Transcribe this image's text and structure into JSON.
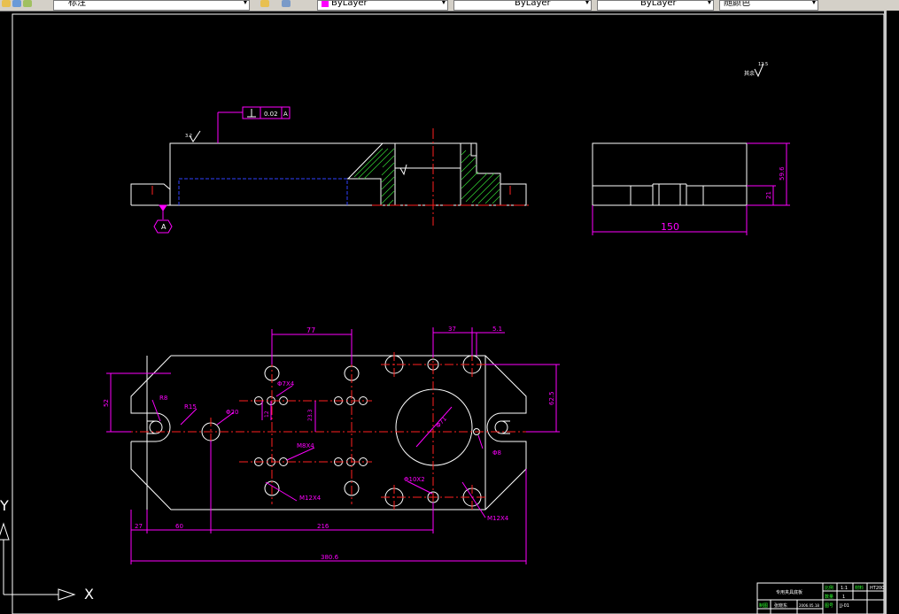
{
  "toolbar": {
    "text_style": "标注",
    "layer": "ByLayer",
    "linetype": "ByLayer",
    "lineweight": "ByLayer",
    "plot_style": "随颜色"
  },
  "drawing": {
    "roughness_note": "其余",
    "roughness_value": "12.5",
    "flatness_tolerance": "0.02",
    "datum_letter": "A",
    "datum_bubble": "A",
    "front_roughness": "3.2",
    "right_view": {
      "width": "150",
      "height": "59.6",
      "step": "21"
    },
    "top_view": {
      "d77": "77",
      "d37": "37",
      "d51": "5.1",
      "d52": "52",
      "d625": "62.5",
      "d233": "23.3",
      "d12": "12",
      "r8": "R8",
      "r15": "R15",
      "phi20": "Φ20",
      "phi7x4": "Φ7X4",
      "m8x4": "M8X4",
      "m12x4_left": "M12X4",
      "phi71": "Φ71",
      "phi8": "Φ8",
      "phi10x2": "Φ10X2",
      "m12x4_right": "M12X4",
      "d27": "27",
      "d60": "60",
      "d216": "216",
      "d3806": "380.6"
    }
  },
  "title_block": {
    "name": "专用夹具底板",
    "ratio_label": "比例",
    "ratio": "1:1",
    "qty_label": "数量",
    "qty": "1",
    "material_label": "材料",
    "material": "HT200",
    "drawn_label": "制图",
    "drawn_by": "张晓东",
    "date": "2006.05.18",
    "sheet_label": "图号",
    "sheet": "JJ-01"
  },
  "ucs": {
    "x": "X",
    "y": "Y"
  }
}
